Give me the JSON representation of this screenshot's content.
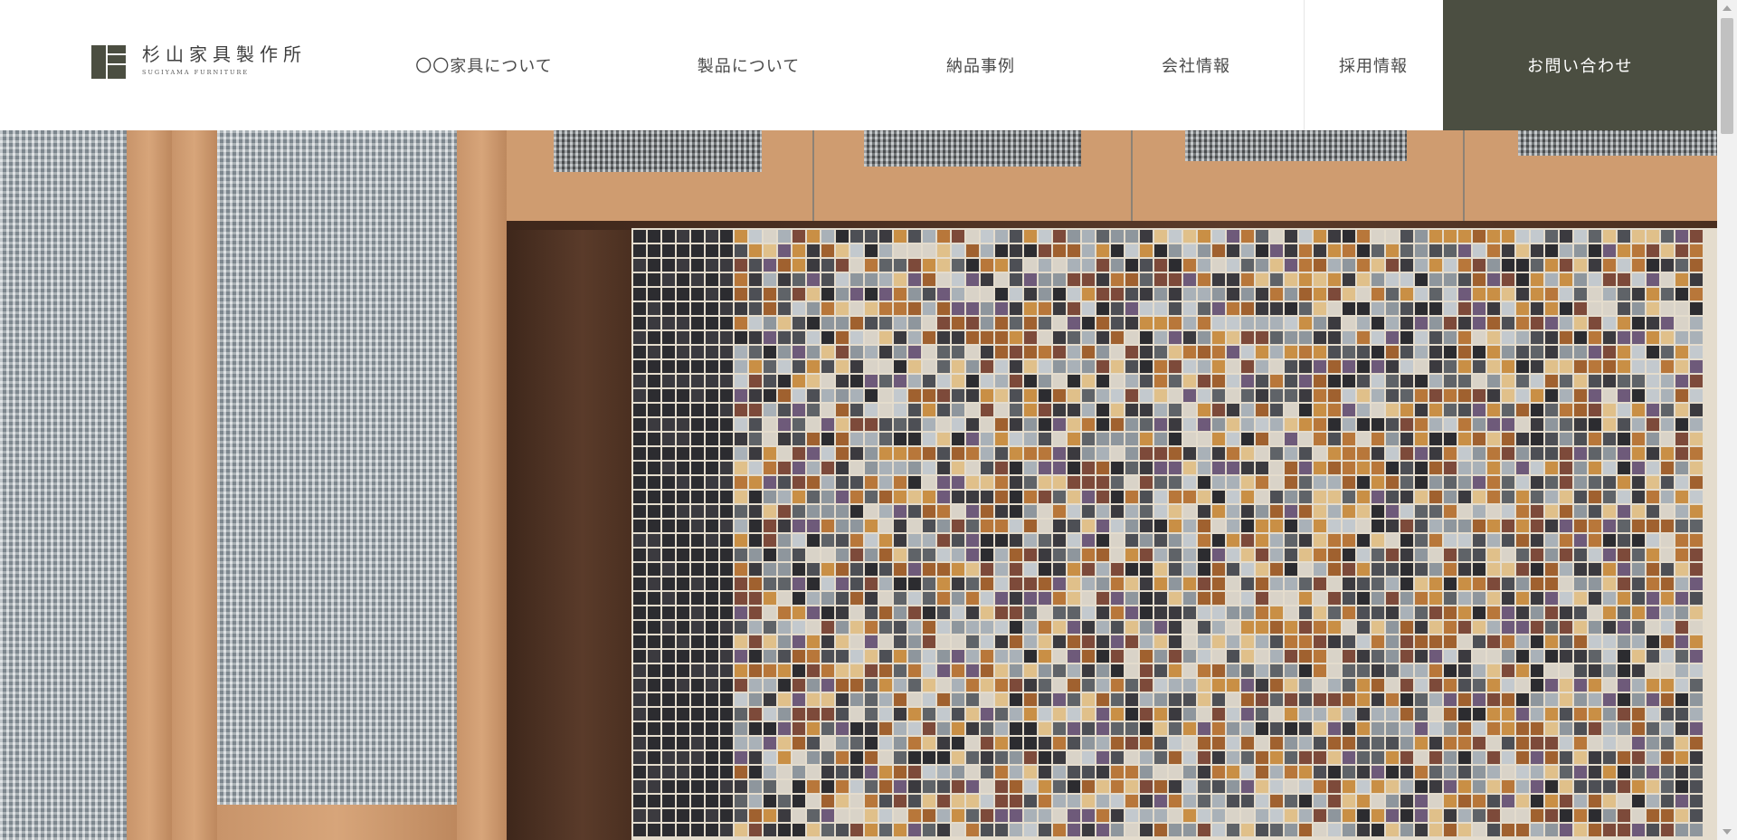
{
  "header": {
    "logo": {
      "name_jp": "杉山家具製作所",
      "name_en": "SUGIYAMA FURNITURE"
    },
    "nav": [
      {
        "label": "〇〇家具について"
      },
      {
        "label": "製品について"
      },
      {
        "label": "納品事例"
      },
      {
        "label": "会社情報"
      },
      {
        "label": "採用情報"
      },
      {
        "label": "お問い合わせ"
      }
    ]
  },
  "hero": {
    "image": "glass-door-cabinet-with-mosaic-tile-backsplash"
  },
  "colors": {
    "accent": "#4b4e41",
    "nav_text": "#4a4a4a",
    "background": "#ffffff"
  }
}
